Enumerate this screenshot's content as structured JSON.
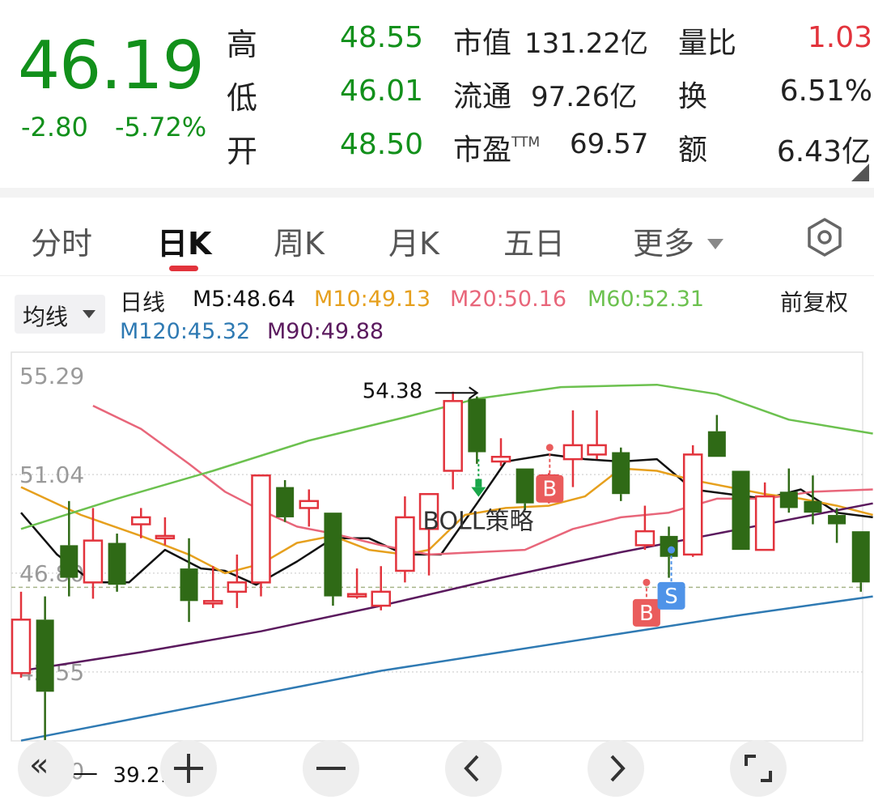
{
  "quote": {
    "price": "46.19",
    "change": "-2.80",
    "change_pct": "-5.72%",
    "rows": [
      {
        "label": "高",
        "value": "48.55",
        "k2": "市值",
        "v2": "131.22亿",
        "k3": "量比",
        "v3": "1.03"
      },
      {
        "label": "低",
        "value": "46.01",
        "k2": "流通",
        "v2": "97.26亿",
        "k3": "换",
        "v3": "6.51%"
      },
      {
        "label": "开",
        "value": "48.50",
        "k2": "市盈",
        "k2_sup": "TTM",
        "v2": "69.57",
        "k3": "额",
        "v3": "6.43亿"
      }
    ]
  },
  "tabs": [
    {
      "label": "分时"
    },
    {
      "label": "日K",
      "active": true
    },
    {
      "label": "周K"
    },
    {
      "label": "月K"
    },
    {
      "label": "五日"
    },
    {
      "label": "更多"
    }
  ],
  "indicator_bar": {
    "ma_button": "均线",
    "period": "日线",
    "ma": [
      {
        "label": "M5:48.64",
        "color": "#111111"
      },
      {
        "label": "M10:49.13",
        "color": "#e6a01e"
      },
      {
        "label": "M20:50.16",
        "color": "#e8667a"
      },
      {
        "label": "M60:52.31",
        "color": "#6cc14f"
      },
      {
        "label": "M120:45.32",
        "color": "#2f7ab3"
      },
      {
        "label": "M90:49.88",
        "color": "#5b1a5e"
      }
    ],
    "adjust": "前复权"
  },
  "chart_data": {
    "type": "candlestick",
    "y_ticks": [
      "55.29",
      "51.04",
      "46.80",
      "42.55",
      "38.30"
    ],
    "y_tick_values": [
      55.29,
      51.04,
      46.8,
      42.55,
      38.3
    ],
    "ylim": [
      38.3,
      55.29
    ],
    "high_label": "54.38",
    "low_label": "39.21",
    "last_price": 46.19,
    "strategy_label": "BOLL策略",
    "signals": [
      "B",
      "B",
      "S"
    ],
    "candles": [
      {
        "o": 42.5,
        "c": 44.8,
        "h": 46.0,
        "l": 42.3
      },
      {
        "o": 44.8,
        "c": 41.7,
        "h": 45.8,
        "l": 38.9
      },
      {
        "o": 48.0,
        "c": 46.6,
        "h": 49.9,
        "l": 45.8
      },
      {
        "o": 46.4,
        "c": 48.2,
        "h": 49.6,
        "l": 45.7
      },
      {
        "o": 48.1,
        "c": 46.3,
        "h": 48.5,
        "l": 46.0
      },
      {
        "o": 48.9,
        "c": 49.2,
        "h": 49.6,
        "l": 48.3
      },
      {
        "o": 48.4,
        "c": 48.4,
        "h": 49.2,
        "l": 48.0
      },
      {
        "o": 47.0,
        "c": 45.6,
        "h": 48.3,
        "l": 44.7
      },
      {
        "o": 45.6,
        "c": 45.6,
        "h": 47.1,
        "l": 45.3
      },
      {
        "o": 46.0,
        "c": 46.4,
        "h": 47.6,
        "l": 45.3
      },
      {
        "o": 46.4,
        "c": 51.0,
        "h": 51.0,
        "l": 45.8
      },
      {
        "o": 50.5,
        "c": 49.2,
        "h": 50.8,
        "l": 49.0
      },
      {
        "o": 49.6,
        "c": 49.9,
        "h": 50.4,
        "l": 48.8
      },
      {
        "o": 49.4,
        "c": 45.8,
        "h": 49.4,
        "l": 45.4
      },
      {
        "o": 45.9,
        "c": 45.9,
        "h": 47.0,
        "l": 45.7
      },
      {
        "o": 45.4,
        "c": 46.0,
        "h": 47.1,
        "l": 45.2
      },
      {
        "o": 46.9,
        "c": 49.2,
        "h": 50.1,
        "l": 46.4
      },
      {
        "o": 48.7,
        "c": 50.2,
        "h": 50.2,
        "l": 46.7
      },
      {
        "o": 51.2,
        "c": 54.2,
        "h": 54.6,
        "l": 50.4
      },
      {
        "o": 54.3,
        "c": 52.0,
        "h": 54.4,
        "l": 51.5
      },
      {
        "o": 51.6,
        "c": 51.8,
        "h": 52.6,
        "l": 51.4
      },
      {
        "o": 51.3,
        "c": 49.8,
        "h": 51.3,
        "l": 49.5
      },
      {
        "o": 50.1,
        "c": 51.0,
        "h": 51.1,
        "l": 49.8
      },
      {
        "o": 51.7,
        "c": 52.3,
        "h": 53.8,
        "l": 50.5
      },
      {
        "o": 51.9,
        "c": 52.3,
        "h": 53.8,
        "l": 51.7
      },
      {
        "o": 52.0,
        "c": 50.2,
        "h": 52.2,
        "l": 49.9
      },
      {
        "o": 48.0,
        "c": 48.6,
        "h": 49.7,
        "l": 47.8
      },
      {
        "o": 48.4,
        "c": 47.5,
        "h": 48.8,
        "l": 46.6
      },
      {
        "o": 47.6,
        "c": 51.9,
        "h": 52.3,
        "l": 47.5
      },
      {
        "o": 52.9,
        "c": 51.8,
        "h": 53.6,
        "l": 51.8
      },
      {
        "o": 51.2,
        "c": 47.8,
        "h": 51.2,
        "l": 47.8
      },
      {
        "o": 47.8,
        "c": 50.1,
        "h": 50.7,
        "l": 47.8
      },
      {
        "o": 50.3,
        "c": 49.6,
        "h": 51.3,
        "l": 49.4
      },
      {
        "o": 49.9,
        "c": 49.4,
        "h": 51.0,
        "l": 48.9
      },
      {
        "o": 49.3,
        "c": 48.9,
        "h": 49.6,
        "l": 48.1
      },
      {
        "o": 48.6,
        "c": 46.4,
        "h": 48.6,
        "l": 46.0
      }
    ],
    "series": [
      {
        "name": "M5",
        "color": "#111111",
        "values": [
          {
            "x": 0.0,
            "y": 49.4
          },
          {
            "x": 1.5,
            "y": 47.6
          },
          {
            "x": 3.0,
            "y": 46.4
          },
          {
            "x": 4.5,
            "y": 46.4
          },
          {
            "x": 6.0,
            "y": 47.8
          },
          {
            "x": 7.5,
            "y": 47.0
          },
          {
            "x": 8.5,
            "y": 46.9
          },
          {
            "x": 9.8,
            "y": 46.3
          },
          {
            "x": 11.5,
            "y": 47.3
          },
          {
            "x": 13.0,
            "y": 48.3
          },
          {
            "x": 14.5,
            "y": 48.3
          },
          {
            "x": 16.0,
            "y": 47.6
          },
          {
            "x": 17.5,
            "y": 47.6
          },
          {
            "x": 19.0,
            "y": 49.8
          },
          {
            "x": 20.2,
            "y": 51.6
          },
          {
            "x": 22.0,
            "y": 51.9
          },
          {
            "x": 23.5,
            "y": 51.7
          },
          {
            "x": 25.0,
            "y": 51.6
          },
          {
            "x": 26.5,
            "y": 51.7
          },
          {
            "x": 28.0,
            "y": 50.4
          },
          {
            "x": 29.5,
            "y": 50.2
          },
          {
            "x": 31.0,
            "y": 50.0
          },
          {
            "x": 32.5,
            "y": 50.4
          },
          {
            "x": 34.0,
            "y": 49.4
          },
          {
            "x": 35.5,
            "y": 49.2
          }
        ]
      },
      {
        "name": "M10",
        "color": "#e6a01e",
        "values": [
          {
            "x": 0.0,
            "y": 50.5
          },
          {
            "x": 2.5,
            "y": 49.3
          },
          {
            "x": 5.0,
            "y": 48.4
          },
          {
            "x": 7.0,
            "y": 47.6
          },
          {
            "x": 8.5,
            "y": 46.8
          },
          {
            "x": 10.0,
            "y": 47.2
          },
          {
            "x": 11.5,
            "y": 48.1
          },
          {
            "x": 13.0,
            "y": 48.4
          },
          {
            "x": 14.5,
            "y": 47.8
          },
          {
            "x": 16.0,
            "y": 47.6
          },
          {
            "x": 17.0,
            "y": 47.8
          },
          {
            "x": 18.5,
            "y": 49.3
          },
          {
            "x": 20.2,
            "y": 49.6
          },
          {
            "x": 22.0,
            "y": 49.7
          },
          {
            "x": 23.5,
            "y": 50.1
          },
          {
            "x": 25.0,
            "y": 51.3
          },
          {
            "x": 26.5,
            "y": 51.2
          },
          {
            "x": 28.0,
            "y": 50.8
          },
          {
            "x": 29.5,
            "y": 50.5
          },
          {
            "x": 31.0,
            "y": 50.2
          },
          {
            "x": 32.5,
            "y": 50.0
          },
          {
            "x": 34.0,
            "y": 49.7
          },
          {
            "x": 35.5,
            "y": 49.3
          }
        ]
      },
      {
        "name": "M20",
        "color": "#e8667a",
        "values": [
          {
            "x": 3.0,
            "y": 54.0
          },
          {
            "x": 5.0,
            "y": 53.0
          },
          {
            "x": 7.0,
            "y": 51.5
          },
          {
            "x": 8.5,
            "y": 50.3
          },
          {
            "x": 10.0,
            "y": 49.5
          },
          {
            "x": 11.5,
            "y": 48.8
          },
          {
            "x": 13.0,
            "y": 48.5
          },
          {
            "x": 15.0,
            "y": 48.0
          },
          {
            "x": 17.0,
            "y": 47.6
          },
          {
            "x": 19.0,
            "y": 47.7
          },
          {
            "x": 21.0,
            "y": 47.8
          },
          {
            "x": 23.0,
            "y": 48.7
          },
          {
            "x": 25.0,
            "y": 49.2
          },
          {
            "x": 27.0,
            "y": 49.4
          },
          {
            "x": 29.0,
            "y": 50.0
          },
          {
            "x": 31.0,
            "y": 50.0
          },
          {
            "x": 33.0,
            "y": 50.3
          },
          {
            "x": 35.5,
            "y": 50.4
          }
        ]
      },
      {
        "name": "M60",
        "color": "#6cc14f",
        "values": [
          {
            "x": 0.0,
            "y": 48.7
          },
          {
            "x": 4.0,
            "y": 50.0
          },
          {
            "x": 8.0,
            "y": 51.2
          },
          {
            "x": 12.0,
            "y": 52.5
          },
          {
            "x": 16.0,
            "y": 53.5
          },
          {
            "x": 19.0,
            "y": 54.3
          },
          {
            "x": 22.5,
            "y": 54.8
          },
          {
            "x": 26.5,
            "y": 54.9
          },
          {
            "x": 29.0,
            "y": 54.5
          },
          {
            "x": 32.0,
            "y": 53.4
          },
          {
            "x": 35.5,
            "y": 52.8
          }
        ]
      },
      {
        "name": "M120",
        "color": "#2f7ab3",
        "values": [
          {
            "x": 0.0,
            "y": 39.6
          },
          {
            "x": 5.0,
            "y": 40.6
          },
          {
            "x": 10.0,
            "y": 41.6
          },
          {
            "x": 15.0,
            "y": 42.6
          },
          {
            "x": 20.0,
            "y": 43.4
          },
          {
            "x": 25.0,
            "y": 44.2
          },
          {
            "x": 30.0,
            "y": 45.0
          },
          {
            "x": 35.5,
            "y": 45.8
          }
        ]
      },
      {
        "name": "M90",
        "color": "#5b1a5e",
        "values": [
          {
            "x": 0.0,
            "y": 42.6
          },
          {
            "x": 5.0,
            "y": 43.4
          },
          {
            "x": 10.0,
            "y": 44.3
          },
          {
            "x": 15.0,
            "y": 45.4
          },
          {
            "x": 20.0,
            "y": 46.6
          },
          {
            "x": 25.0,
            "y": 47.7
          },
          {
            "x": 30.0,
            "y": 48.7
          },
          {
            "x": 35.5,
            "y": 49.8
          }
        ]
      }
    ]
  }
}
